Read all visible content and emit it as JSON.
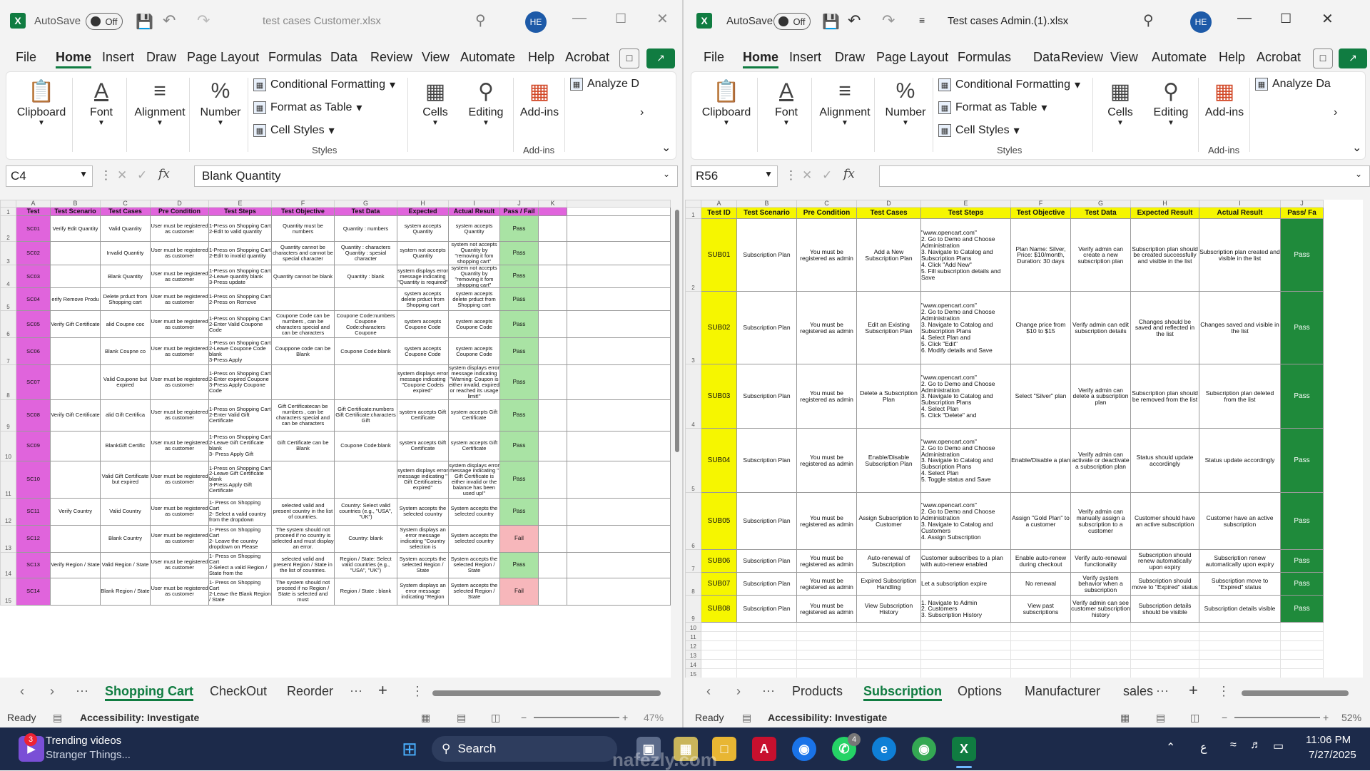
{
  "left": {
    "autosave_label": "AutoSave",
    "autosave_state": "Off",
    "filename": "test cases Customer.xlsx",
    "avatar": "HE",
    "menu": [
      "File",
      "Home",
      "Insert",
      "Draw",
      "Page Layout",
      "Formulas",
      "Data",
      "Review",
      "View",
      "Automate",
      "Help",
      "Acrobat"
    ],
    "ribbon": {
      "clipboard": "Clipboard",
      "font": "Font",
      "alignment": "Alignment",
      "number": "Number",
      "cond_fmt": "Conditional Formatting",
      "fmt_table": "Format as Table",
      "cell_styles": "Cell Styles",
      "styles": "Styles",
      "cells": "Cells",
      "editing": "Editing",
      "addins": "Add-ins",
      "addins_group": "Add-ins",
      "analyze": "Analyze D"
    },
    "namebox": "C4",
    "formula": "Blank Quantity",
    "col_letters": [
      "A",
      "B",
      "C",
      "D",
      "E",
      "F",
      "G",
      "H",
      "I",
      "J",
      "K"
    ],
    "headers": [
      "Test",
      "Test Scenario",
      "Test Cases",
      "Pre Condition",
      "Test Steps",
      "Test Objective",
      "Test Data",
      "Expected",
      "Actual Result",
      "Pass / Fail",
      ""
    ],
    "rows": [
      {
        "n": "2",
        "id": "SC01",
        "scenario": "Verify Edit Quantity",
        "case": "Valid Quantity",
        "pre": "User must be registered as customer",
        "steps": "1-Press on Shopping Cart\n2-Edit to valid quantity",
        "obj": "Quantity must be numbers",
        "data": "Quantity : numbers",
        "exp": "system accepts Quantity",
        "act": "system accepts Quantity",
        "res": "Pass"
      },
      {
        "n": "3",
        "id": "SC02",
        "scenario": "",
        "case": "Invalid Quantity",
        "pre": "User must be registered as customer",
        "steps": "1-Press on Shopping Cart\n2-Edit to invalid quantity",
        "obj": "Quantity cannot be characters and cannot be special character",
        "data": "Quantity : characters Quantity : spesial character",
        "exp": "system not accepts Quantity",
        "act": "system not accepts Quantity by \"removing it fom shopping cart\"",
        "res": "Pass"
      },
      {
        "n": "4",
        "id": "SC03",
        "scenario": "",
        "case": "Blank Quantity",
        "pre": "User must be registered as customer",
        "steps": "1-Press on Shopping Cart\n2-Leave quantity blank\n3-Press update",
        "obj": "Quantity cannot be blank",
        "data": "Quantity : blank",
        "exp": "system displays error message indicating \"Quantity is required\"",
        "act": "system not accepts Quantity by \"removing it fom shopping cart\"",
        "res": "Pass"
      },
      {
        "n": "5",
        "id": "SC04",
        "scenario": "erify Remove Produ",
        "case": "Delete prduct from Shopping cart",
        "pre": "User must be registered as customer",
        "steps": "1-Press on Shopping Cart\n2-Press on Remove",
        "obj": "",
        "data": "",
        "exp": "system accepts delete prduct from Shopping cart",
        "act": "system accepts delete prduct from Shopping cart",
        "res": "Pass"
      },
      {
        "n": "6",
        "id": "SC05",
        "scenario": "Verify Gift Certificate",
        "case": "alid Coupne coc",
        "pre": "User must be registered as customer",
        "steps": "1-Press on Shopping Cart\n2-Enter Valid Coupone Code",
        "obj": "Coupone Code can be numbers , can be characters special and can be characters",
        "data": "Coupone Code:numbers Coupone Code:characters Coupone",
        "exp": "system accepts Coupone Code",
        "act": "system accepts Coupone Code",
        "res": "Pass"
      },
      {
        "n": "7",
        "id": "SC06",
        "scenario": "",
        "case": "Blank Coupne co",
        "pre": "User must be registered as customer",
        "steps": "1-Press on Shopping Cart\n2-Leave Coupone Code blank\n3-Press Apply",
        "obj": "Couppone code can be Blank",
        "data": "Coupone Code:blank",
        "exp": "system accepts Coupone Code",
        "act": "system accepts Coupone Code",
        "res": "Pass"
      },
      {
        "n": "8",
        "id": "SC07",
        "scenario": "",
        "case": "Valid Coupone but expired",
        "pre": "User must be registered as customer",
        "steps": "1-Press on Shopping Cart\n2-Enter expired Coupone\n3-Press Apply Coupone Code",
        "obj": "",
        "data": "",
        "exp": "system displays error message indicating \"Coupone Codeis expired\"",
        "act": "system displays error message indicating \"Warning: Coupon is either invalid, expired or reached its usage limit!\"",
        "res": "Pass"
      },
      {
        "n": "9",
        "id": "SC08",
        "scenario": "Verify Gift Certificate",
        "case": "alid Gift Certifica",
        "pre": "User must be registered as customer",
        "steps": "1-Press on Shopping Cart\n2-Enter Valid Gift Certificate",
        "obj": "Gift Certificatecan be numbers , can be characters special and can be characters",
        "data": "Gift Certificate:numbers Gift Certificate:characters Gift",
        "exp": "system accepts Gift Certificate",
        "act": "system accepts Gift Certificate",
        "res": "Pass"
      },
      {
        "n": "10",
        "id": "SC09",
        "scenario": "",
        "case": "BlankGift Certific",
        "pre": "User must be registered as customer",
        "steps": "1-Press on Shopping Cart\n2-Leave Gift Certificate blank\n3- Press Apply Gift",
        "obj": "Gift Certificate can be Blank",
        "data": "Coupone Code:blank",
        "exp": "system accepts Gift Certificate",
        "act": "system accepts Gift Certificate",
        "res": "Pass"
      },
      {
        "n": "11",
        "id": "SC10",
        "scenario": "",
        "case": "Valid Gift Certificate but expired",
        "pre": "User must be registered as customer",
        "steps": "1-Press on Shopping Cart\n2-Leave Gift Certificate blank\n3-Press Apply Gift Certificate",
        "obj": "",
        "data": "",
        "exp": "system displays error message indicating \" Gift Certificateis expired\"",
        "act": "system displays error message indicating \" Gift Certificate is either invalid or the balance has been used up!\"",
        "res": "Pass"
      },
      {
        "n": "12",
        "id": "SC11",
        "scenario": "Verify Country",
        "case": "Valid Country",
        "pre": "User must be registered as customer",
        "steps": "1- Press on Shopping Cart\n2- Select a valid country from the dropdown",
        "obj": "selected valid and present country in the list of countries.",
        "data": "Country: Select valid countries (e.g., \"USA\", \"UK\")",
        "exp": "System accepts the selected country",
        "act": "System accepts the selected country",
        "res": "Pass"
      },
      {
        "n": "13",
        "id": "SC12",
        "scenario": "",
        "case": "Blank Country",
        "pre": "User must be registered as customer",
        "steps": "1- Press on Shopping Cart\n2- Leave the country dropdown on Please",
        "obj": "The system should not proceed if no country is selected and must display an error.",
        "data": "Country: blank",
        "exp": "System displays an error message indicating \"Country selection is",
        "act": "System accepts the selected country",
        "res": "Fail"
      },
      {
        "n": "14",
        "id": "SC13",
        "scenario": "Verify Region / State",
        "case": "Valid Region / State",
        "pre": "User must be registered as customer",
        "steps": "1- Press on Shopping Cart\n2-Select a valid Region / State from the",
        "obj": "selected valid and present Region / State in the list of countries.",
        "data": "Region / State: Select valid countries (e.g., \"USA\", \"UK\")",
        "exp": "System accepts the selected Region / State",
        "act": "System accepts the selected Region / State",
        "res": "Pass"
      },
      {
        "n": "15",
        "id": "SC14",
        "scenario": "",
        "case": "Blank Region / State",
        "pre": "User must be registered as customer",
        "steps": "1- Press on Shopping Cart\n2-Leave the Blank Region / State",
        "obj": "The system should not proceed if no Region / State is selected and must",
        "data": "Region / State : blank",
        "exp": "System displays an error message indicating \"Region",
        "act": "System accepts the selected Region / State",
        "res": "Fail"
      }
    ],
    "tabs": [
      "Shopping Cart",
      "CheckOut",
      "Reorder"
    ],
    "status": "Ready",
    "accessibility": "Accessibility: Investigate",
    "zoom": "47%"
  },
  "right": {
    "autosave_label": "AutoSave",
    "autosave_state": "Off",
    "filename": "Test cases Admin.(1).xlsx",
    "avatar": "HE",
    "menu": [
      "File",
      "Home",
      "Insert",
      "Draw",
      "Page Layout",
      "Formulas",
      "Data",
      "Review",
      "View",
      "Automate",
      "Help",
      "Acrobat"
    ],
    "ribbon": {
      "clipboard": "Clipboard",
      "font": "Font",
      "alignment": "Alignment",
      "number": "Number",
      "cond_fmt": "Conditional Formatting",
      "fmt_table": "Format as Table",
      "cell_styles": "Cell Styles",
      "styles": "Styles",
      "cells": "Cells",
      "editing": "Editing",
      "addins": "Add-ins",
      "addins_group": "Add-ins",
      "analyze": "Analyze Da"
    },
    "namebox": "R56",
    "formula": "",
    "col_letters": [
      "A",
      "B",
      "C",
      "D",
      "E",
      "F",
      "G",
      "H",
      "I",
      "J"
    ],
    "headers": [
      "Test ID",
      "Test Scenario",
      "Pre Condition",
      "Test Cases",
      "Test Steps",
      "Test Objective",
      "Test Data",
      "Expected Result",
      "Actual Result",
      "Pass/ Fa"
    ],
    "rows": [
      {
        "n": "2",
        "id": "SUB01",
        "scenario": "Subscription Plan",
        "pre": "You must be registered as admin",
        "case": "Add a New Subscription Plan",
        "steps": "\"www.opencart.com\"\n2. Go to Demo and Choose Administration\n3. Navigate to Catalog and Subscription Plans\n4. Click \"Add New\"\n5. Fill subscription details and Save",
        "obj": "Plan Name: Silver, Price: $10/month, Duration: 30 days",
        "data": "Verify admin can create a new subscription plan",
        "exp": "Subscription plan should be created successfully and visible in the list",
        "act": "Subscription plan created and visible in the list",
        "res": "Pass"
      },
      {
        "n": "3",
        "id": "SUB02",
        "scenario": "Subscription Plan",
        "pre": "You must be registered as admin",
        "case": "Edit an Existing Subscription Plan",
        "steps": "\"www.opencart.com\"\n2. Go to Demo and Choose Administration\n3. Navigate to Catalog and Subscription Plans\n4. Select Plan and\n5. Click \"Edit\"\n6. Modify details and Save",
        "obj": "Change price from $10 to $15",
        "data": "Verify admin can edit subscription details",
        "exp": "Changes should be saved and reflected in the list",
        "act": "Changes saved and visible in the list",
        "res": "Pass"
      },
      {
        "n": "4",
        "id": "SUB03",
        "scenario": "Subscription Plan",
        "pre": "You must be registered as admin",
        "case": "Delete a Subscription Plan",
        "steps": "\"www.opencart.com\"\n2. Go to Demo and Choose Administration\n3. Navigate to Catalog and Subscription Plans\n4. Select Plan\n5. Click \"Delete\" and",
        "obj": "Select \"Silver\" plan",
        "data": "Verify admin can delete a subscription plan",
        "exp": "Subscription plan should be removed from the list",
        "act": "Subscription plan deleted from the list",
        "res": "Pass"
      },
      {
        "n": "5",
        "id": "SUB04",
        "scenario": "Subscription Plan",
        "pre": "You must be registered as admin",
        "case": "Enable/Disable Subscription Plan",
        "steps": "\"www.opencart.com\"\n2. Go to Demo and Choose Administration\n3. Navigate to Catalog and Subscription Plans\n4. Select Plan\n5. Toggle status and Save",
        "obj": "Enable/Disable a plan",
        "data": "Verify admin can activate or deactivate a subscription plan",
        "exp": "Status should update accordingly",
        "act": "Status update accordingly",
        "res": "Pass"
      },
      {
        "n": "6",
        "id": "SUB05",
        "scenario": "Subscription Plan",
        "pre": "You must be registered as admin",
        "case": "Assign Subscription to Customer",
        "steps": "\"www.opencart.com\"\n2. Go to Demo and Choose Administration\n3. Navigate to Catalog and Customers\n4. Assign Subscription",
        "obj": "Assign \"Gold Plan\" to a customer",
        "data": "Verify admin can manually assign a subscription to a customer",
        "exp": "Customer should have an active subscription",
        "act": "Customer have an active subscription",
        "res": "Pass"
      },
      {
        "n": "7",
        "id": "SUB06",
        "scenario": "Subscription Plan",
        "pre": "You must be registered as admin",
        "case": "Auto-renewal of Subscription",
        "steps": "Customer subscribes to a plan with auto-renew enabled",
        "obj": "Enable auto-renew during checkout",
        "data": "Verify auto-renewal functionality",
        "exp": "Subscription should renew automatically upon expiry",
        "act": "Subscription renew automatically upon expiry",
        "res": "Pass"
      },
      {
        "n": "8",
        "id": "SUB07",
        "scenario": "Subscription Plan",
        "pre": "You must be registered as admin",
        "case": "Expired Subscription Handling",
        "steps": "Let a subscription expire",
        "obj": "No renewal",
        "data": "Verify system behavior when a subscription",
        "exp": "Subscription should move to \"Expired\" status",
        "act": "Subscription move to \"Expired\" status",
        "res": "Pass"
      },
      {
        "n": "9",
        "id": "SUB08",
        "scenario": "Subscription Plan",
        "pre": "You must be registered as admin",
        "case": "View Subscription History",
        "steps": "1. Navigate to Admin\n2. Customers\n3. Subscription History",
        "obj": "View past subscriptions",
        "data": "Verify admin can see customer subscription history",
        "exp": "Subscription details should be visible",
        "act": "Subscription details visible",
        "res": "Pass"
      }
    ],
    "empty_rows": [
      "10",
      "11",
      "12",
      "13",
      "14",
      "15"
    ],
    "tabs": [
      "Products",
      "Subscription",
      "Options",
      "Manufacturer",
      "sales"
    ],
    "status": "Ready",
    "accessibility": "Accessibility: Investigate",
    "zoom": "52%"
  },
  "taskbar": {
    "video_title": "Trending videos",
    "video_sub": "Stranger Things...",
    "badge": "3",
    "search": "Search",
    "whatsapp_badge": "4",
    "time": "11:06 PM",
    "date": "7/27/2025",
    "watermark": "nafezly.com"
  },
  "colors": {
    "excel_green": "#107c41",
    "magenta": "#e064dc",
    "yellow": "#f6f600",
    "pass_green": "#a9e3a4",
    "fail_red": "#f7b7bb",
    "dark_green": "#1f8a3b"
  }
}
